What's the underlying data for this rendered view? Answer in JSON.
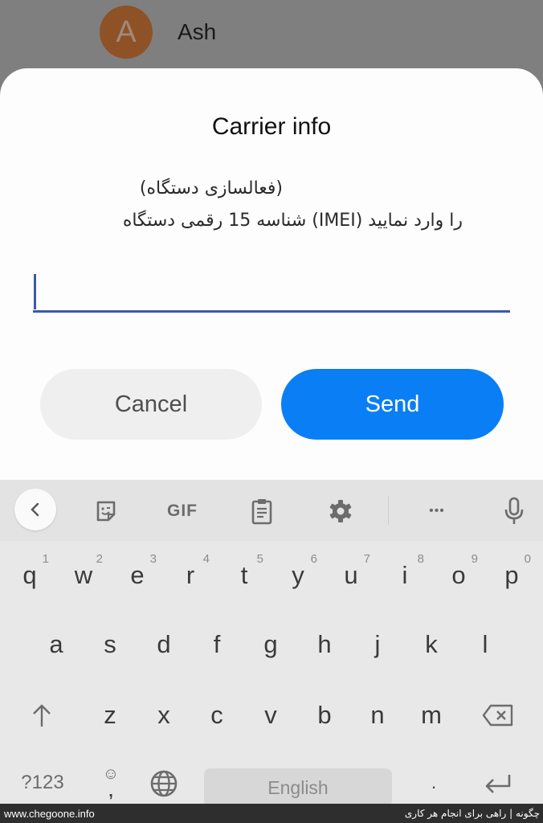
{
  "background": {
    "contact": {
      "avatar_letter": "A",
      "name": "Ash",
      "avatar_color": "#8e5226"
    }
  },
  "dialog": {
    "title": "Carrier info",
    "message_line1": "(فعالسازی دستگاه)",
    "message_line2": "را وارد نمایید (IMEI) شناسه 15 رقمی دستگاه",
    "input": {
      "value": "",
      "placeholder": ""
    },
    "cancel_label": "Cancel",
    "send_label": "Send",
    "accent_color": "#0a7ff5"
  },
  "keyboard": {
    "toolbar": [
      {
        "name": "back",
        "icon": "chevron-left-icon",
        "glyph": "‹"
      },
      {
        "name": "sticker",
        "icon": "sticker-icon"
      },
      {
        "name": "gif",
        "label": "GIF"
      },
      {
        "name": "clipboard",
        "icon": "clipboard-icon"
      },
      {
        "name": "settings",
        "icon": "gear-icon"
      },
      {
        "name": "more",
        "icon": "more-icon",
        "glyph": "•••"
      },
      {
        "name": "voice",
        "icon": "microphone-icon"
      }
    ],
    "row1": [
      {
        "key": "q",
        "hint": "1"
      },
      {
        "key": "w",
        "hint": "2"
      },
      {
        "key": "e",
        "hint": "3"
      },
      {
        "key": "r",
        "hint": "4"
      },
      {
        "key": "t",
        "hint": "5"
      },
      {
        "key": "y",
        "hint": "6"
      },
      {
        "key": "u",
        "hint": "7"
      },
      {
        "key": "i",
        "hint": "8"
      },
      {
        "key": "o",
        "hint": "9"
      },
      {
        "key": "p",
        "hint": "0"
      }
    ],
    "row2": [
      "a",
      "s",
      "d",
      "f",
      "g",
      "h",
      "j",
      "k",
      "l"
    ],
    "row3": [
      "z",
      "x",
      "c",
      "v",
      "b",
      "n",
      "m"
    ],
    "shift_glyph": "↑",
    "symbols_label": "?123",
    "comma_label": ",",
    "emoji_glyph": "☺",
    "space_label": "English",
    "period_label": ".",
    "enter_glyph": "↵"
  },
  "watermark": {
    "left": "www.chegoone.info",
    "right": "چگونه | راهی برای انجام هر کاری"
  }
}
